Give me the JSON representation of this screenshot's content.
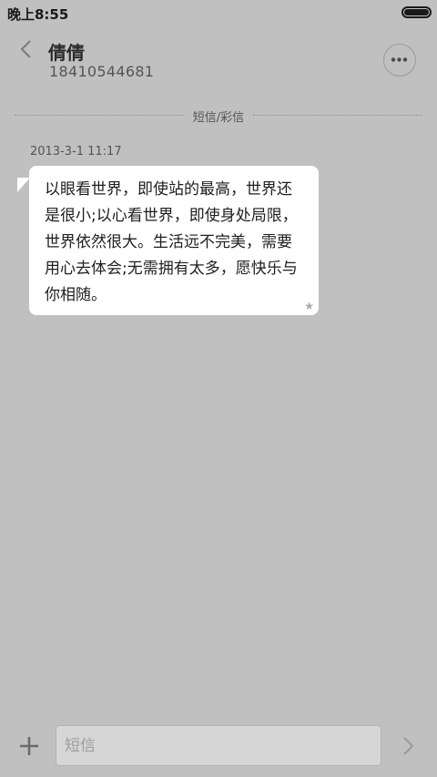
{
  "status_bar": {
    "time": "晚上8:55",
    "battery_level": 1.0
  },
  "header": {
    "contact_name": "倩倩",
    "phone_number": "18410544681"
  },
  "divider": {
    "label": "短信/彩信"
  },
  "message": {
    "timestamp": "2013-3-1 11:17",
    "text": "以眼看世界，即使站的最高，世界还是很小;以心看世界，即使身处局限，世界依然很大。生活远不完美，需要用心去体会;无需拥有太多，愿快乐与你相随。",
    "starred": true
  },
  "composer": {
    "placeholder": "短信",
    "value": ""
  },
  "icons": {
    "back": "chevron-left-icon",
    "more": "ellipsis-icon",
    "star": "star-icon",
    "add": "plus-icon",
    "send": "chevron-right-icon"
  },
  "colors": {
    "background": "#c0c0c0",
    "bubble": "#ffffff",
    "input_bg": "#d6d6d6"
  }
}
